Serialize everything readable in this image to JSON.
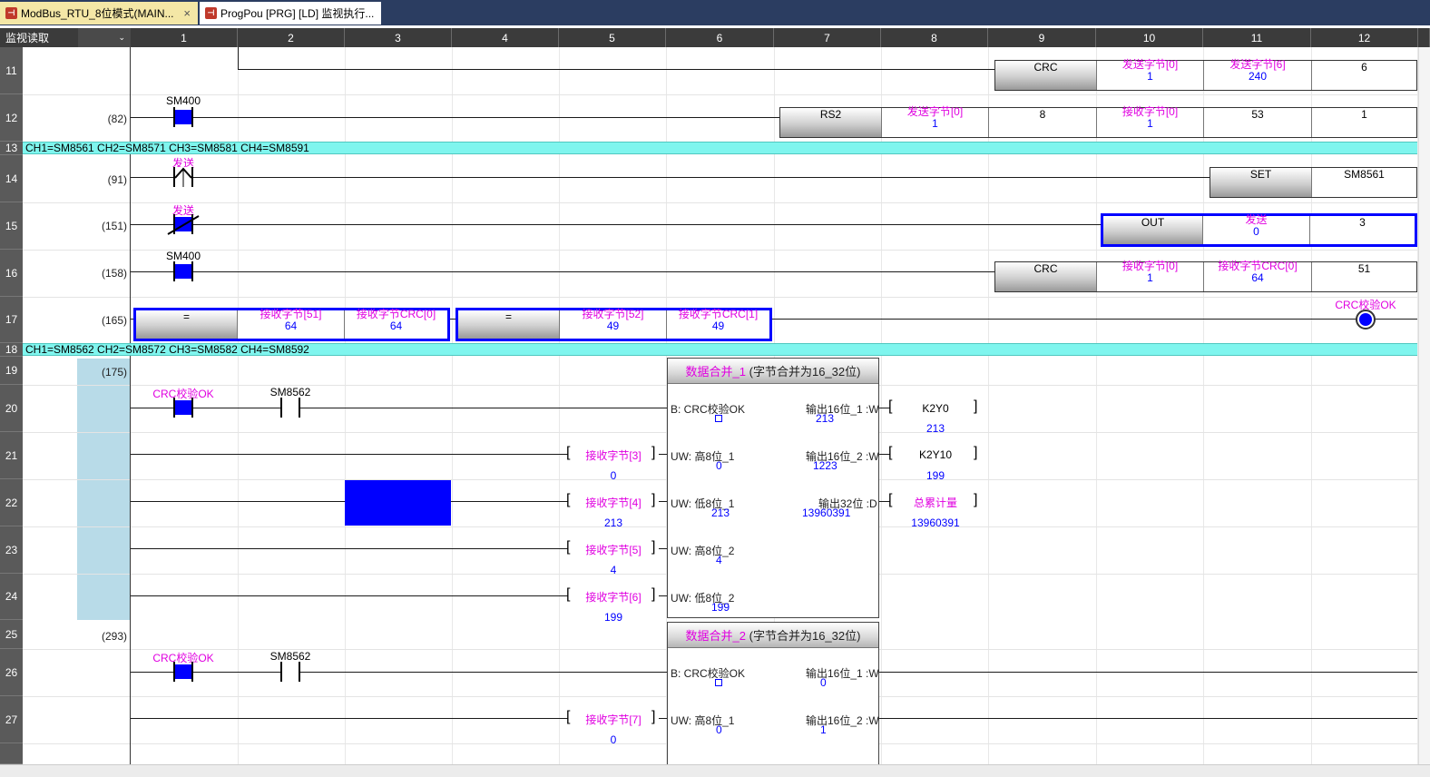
{
  "tabs": [
    {
      "label": "ModBus_RTU_8位模式(MAIN...",
      "close": "×"
    },
    {
      "label": "ProgPou [PRG] [LD] 监视执行..."
    }
  ],
  "tab_icon": "ld",
  "mode": {
    "label": "监视读取",
    "dropdown": "⌄"
  },
  "columns": [
    "1",
    "2",
    "3",
    "4",
    "5",
    "6",
    "7",
    "8",
    "9",
    "10",
    "11",
    "12"
  ],
  "rows": [
    "11",
    "12",
    "13",
    "14",
    "15",
    "16",
    "17",
    "18",
    "19",
    "20",
    "21",
    "22",
    "23",
    "24",
    "25",
    "26",
    "27"
  ],
  "steps": {
    "r12": "(82)",
    "r14": "(91)",
    "r15": "(151)",
    "r16": "(158)",
    "r17": "(165)",
    "r19": "(175)",
    "r25": "(293)"
  },
  "comments": {
    "r13": "CH1=SM8561  CH2=SM8571  CH3=SM8581  CH4=SM8591",
    "r18": "CH1=SM8562  CH2=SM8572  CH3=SM8582  CH4=SM8592"
  },
  "row11": {
    "op": "CRC",
    "a_lbl": "发送字节[0]",
    "a_val": "1",
    "b_lbl": "发送字节[6]",
    "b_val": "240",
    "n": "6"
  },
  "row12": {
    "contact": "SM400",
    "op": "RS2",
    "a_lbl": "发送字节[0]",
    "a_val": "1",
    "n1": "8",
    "b_lbl": "接收字节[0]",
    "b_val": "1",
    "n2": "53",
    "n3": "1"
  },
  "row14": {
    "contact": "发送",
    "op": "SET",
    "dev": "SM8561"
  },
  "row15": {
    "contact": "发送",
    "op": "OUT",
    "lbl": "发送",
    "val": "0",
    "n": "3"
  },
  "row16": {
    "contact": "SM400",
    "op": "CRC",
    "a_lbl": "接收字节[0]",
    "a_val": "1",
    "b_lbl": "接收字节CRC[0]",
    "b_val": "64",
    "n": "51"
  },
  "row17": {
    "cmp1": {
      "op": "=",
      "a_lbl": "接收字节[51]",
      "a_val": "64",
      "b_lbl": "接收字节CRC[0]",
      "b_val": "64"
    },
    "cmp2": {
      "op": "=",
      "a_lbl": "接收字节[52]",
      "a_val": "49",
      "b_lbl": "接收字节CRC[1]",
      "b_val": "49"
    },
    "coil": "CRC校验OK"
  },
  "fb1": {
    "name": "数据合并_1",
    "desc": "(字节合并为16_32位)",
    "contact1": "CRC校验OK",
    "contact2": "SM8562",
    "in_b": "B: CRC校验OK",
    "in1": "UW: 高8位_1",
    "in1_val": "0",
    "in2": "UW: 低8位_1",
    "in2_val": "213",
    "in3": "UW: 高8位_2",
    "in3_val": "4",
    "in4": "UW: 低8位_2",
    "in4_val": "199",
    "out1": "输出16位_1 :W",
    "out1_val": "213",
    "out2": "输出16位_2 :W",
    "out2_val": "1223",
    "out3": "输出32位 :D",
    "out3_val": "13960391",
    "src1": "接收字节[3]",
    "src1_val": "0",
    "src2": "接收字节[4]",
    "src2_val": "213",
    "src3": "接收字节[5]",
    "src3_val": "4",
    "src4": "接收字节[6]",
    "src4_val": "199",
    "dst1": "K2Y0",
    "dst1_val": "213",
    "dst2": "K2Y10",
    "dst2_val": "199",
    "dst3": "总累计量",
    "dst3_val": "13960391"
  },
  "fb2": {
    "name": "数据合并_2",
    "desc": "(字节合并为16_32位)",
    "contact1": "CRC校验OK",
    "contact2": "SM8562",
    "in_b": "B: CRC校验OK",
    "in1": "UW: 高8位_1",
    "in1_val": "0",
    "out1": "输出16位_1 :W",
    "out1_val": "0",
    "out2": "输出16位_2 :W",
    "out2_val": "1",
    "src1": "接收字节[7]",
    "src1_val": "0"
  },
  "colors": {
    "accent_blue": "#0000ff",
    "magenta": "#e000e0",
    "comment_bg": "#7ff5ee",
    "gutter_shade": "#b8dbe8"
  }
}
